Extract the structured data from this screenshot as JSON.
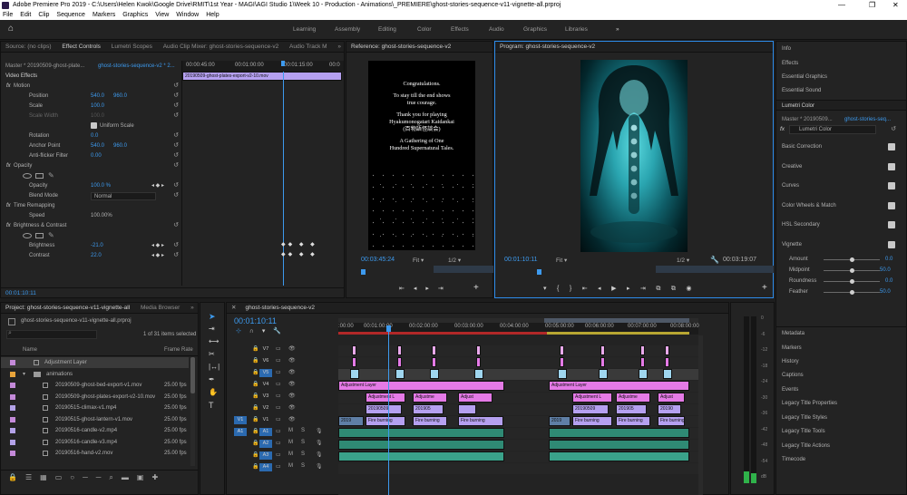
{
  "app": {
    "title": "Adobe Premiere Pro 2019 - C:\\Users\\Helen Kwok\\Google Drive\\RMIT\\1st Year - MAGI\\AGI Studio 1\\Week 10 - Production - Animations\\_PREMIERE\\ghost-stories-sequence-v11-vignette-all.prproj",
    "window_controls": [
      "—",
      "❐",
      "✕"
    ]
  },
  "menu": [
    "File",
    "Edit",
    "Clip",
    "Sequence",
    "Markers",
    "Graphics",
    "View",
    "Window",
    "Help"
  ],
  "workspaces": [
    "Learning",
    "Assembly",
    "Editing",
    "Color",
    "Effects",
    "Audio",
    "Graphics",
    "Libraries",
    "»"
  ],
  "source_panel": {
    "tabs": [
      "Source: (no clips)",
      "Effect Controls",
      "Lumetri Scopes",
      "Audio Clip Mixer: ghost-stories-sequence-v2",
      "Audio Track M",
      "»"
    ],
    "master": "Master * 20190509-ghost-plate...",
    "clip_ref": "ghost-stories-sequence-v2 * 2...",
    "ruler": [
      "00:00:45:00",
      "00:01:00:00",
      "00:01:15:00",
      "00:0"
    ],
    "clip_label": "20190509-ghost-plates-export-v2-10.mov",
    "video_effects": "Video Effects",
    "rows": [
      {
        "label": "fx",
        "name": "Motion"
      },
      {
        "name": "Position",
        "v1": "540.0",
        "v2": "960.0"
      },
      {
        "name": "Scale",
        "v1": "100.0"
      },
      {
        "name": "Scale Width",
        "v1": "100.0"
      },
      {
        "name": "Uniform Scale"
      },
      {
        "name": "Rotation",
        "v1": "0.0"
      },
      {
        "name": "Anchor Point",
        "v1": "540.0",
        "v2": "960.0"
      },
      {
        "name": "Anti-flicker Filter",
        "v1": "0.00"
      },
      {
        "label": "fx",
        "name": "Opacity"
      },
      {
        "name": "Opacity",
        "v1": "100.0 %"
      },
      {
        "name": "Blend Mode",
        "v1": "Normal"
      },
      {
        "label": "fx",
        "name": "Time Remapping"
      },
      {
        "name": "Speed",
        "v1": "100.00%"
      },
      {
        "label": "fx",
        "name": "Brightness & Contrast"
      },
      {
        "name": "Brightness",
        "v1": "-21.0"
      },
      {
        "name": "Contrast",
        "v1": "22.0"
      }
    ],
    "timecode": "00:01:10:11"
  },
  "reference_monitor": {
    "tab": "Reference: ghost-stories-sequence-v2",
    "lines": [
      "Congratulations.",
      "",
      "To stay till the end shows",
      "true courage.",
      "",
      "Thank you for playing",
      "Hyakumonogatari Kaidankai",
      "(百物語怪談会)",
      "",
      "A Gathering of One",
      "Hundred Supernatural Tales."
    ],
    "timecode": "00:03:45:24",
    "fit": "Fit",
    "ratio": "1/2"
  },
  "program_monitor": {
    "tab": "Program: ghost-stories-sequence-v2",
    "timecode": "00:01:10:11",
    "fit": "Fit",
    "ratio": "1/2",
    "duration": "00:03:19:07"
  },
  "right_panels": {
    "items_top": [
      "Info",
      "Effects",
      "Essential Graphics",
      "Essential Sound"
    ],
    "lumetri_title": "Lumetri Color",
    "lumetri_master": "Master * 20190509...",
    "lumetri_seq": "ghost-stories-seq...",
    "lumetri_fx": "Lumetri Color",
    "sections": [
      "Basic Correction",
      "Creative",
      "Curves",
      "Color Wheels & Match",
      "HSL Secondary",
      "Vignette"
    ],
    "vignette": [
      {
        "name": "Amount",
        "value": "0.0",
        "pos": 0.5
      },
      {
        "name": "Midpoint",
        "value": "50.0",
        "pos": 0.5
      },
      {
        "name": "Roundness",
        "value": "0.0",
        "pos": 0.5
      },
      {
        "name": "Feather",
        "value": "50.0",
        "pos": 0.5
      }
    ],
    "items_bottom": [
      "Metadata",
      "Markers",
      "History",
      "Captions",
      "Events",
      "Legacy Title Properties",
      "Legacy Title Styles",
      "Legacy Title Tools",
      "Legacy Title Actions",
      "Timecode"
    ]
  },
  "project_panel": {
    "tabs": [
      "Project: ghost-stories-sequence-v11-vignette-all",
      "Media Browser",
      "»"
    ],
    "file": "ghost-stories-sequence-v11-vignette-all.prproj",
    "selected": "1 of 31 items selected",
    "col_name": "Name",
    "col_rate": "Frame Rate",
    "items": [
      {
        "name": "Adjustment Layer",
        "rate": "",
        "color": "#c48ad9",
        "indent": 0
      },
      {
        "name": "animations",
        "rate": "",
        "color": "#e8a33a",
        "indent": 0
      },
      {
        "name": "20190509-ghost-bed-export-v1.mov",
        "rate": "25.00 fps",
        "color": "#c48ad9",
        "indent": 1
      },
      {
        "name": "20190509-ghost-plates-export-v2-10.mov",
        "rate": "25.00 fps",
        "color": "#c48ad9",
        "indent": 1
      },
      {
        "name": "20190515-climax-v1.mp4",
        "rate": "25.00 fps",
        "color": "#b3a2e8",
        "indent": 1
      },
      {
        "name": "20190515-ghost-lantern-v1.mov",
        "rate": "25.00 fps",
        "color": "#c48ad9",
        "indent": 1
      },
      {
        "name": "20190516-candle-v2.mp4",
        "rate": "25.00 fps",
        "color": "#b3a2e8",
        "indent": 1
      },
      {
        "name": "20190516-candle-v3.mp4",
        "rate": "25.00 fps",
        "color": "#b3a2e8",
        "indent": 1
      },
      {
        "name": "20190516-hand-v2.mov",
        "rate": "25.00 fps",
        "color": "#c48ad9",
        "indent": 1
      }
    ]
  },
  "timeline": {
    "tab": "ghost-stories-sequence-v2",
    "timecode": "00:01:10:11",
    "ruler": [
      ":00:00",
      "00:01:00:00",
      "00:02:00:00",
      "00:03:00:00",
      "00:04:00:00",
      "00:05:00:00",
      "00:06:00:00",
      "00:07:00:00",
      "00:08:00:00"
    ],
    "tracks": [
      "V7",
      "V6",
      "V5",
      "V4",
      "V3",
      "V2",
      "V1",
      "A1",
      "A2",
      "A3",
      "A4"
    ],
    "src_v": "V1",
    "src_a": "A1",
    "clip_labels": {
      "adjustment": "Adjustment Layer",
      "adj_short": "Adjustment L",
      "adjustme": "Adjustme",
      "adjust": "Adjust",
      "fire": "Fire burning",
      "n2019": "2019",
      "n20190509": "20190509",
      "n201905": "201905",
      "n20190": "20190"
    }
  },
  "meter_scale": [
    "0",
    "-6",
    "-12",
    "-18",
    "-24",
    "-30",
    "-36",
    "-42",
    "-48",
    "-54",
    "dB"
  ]
}
